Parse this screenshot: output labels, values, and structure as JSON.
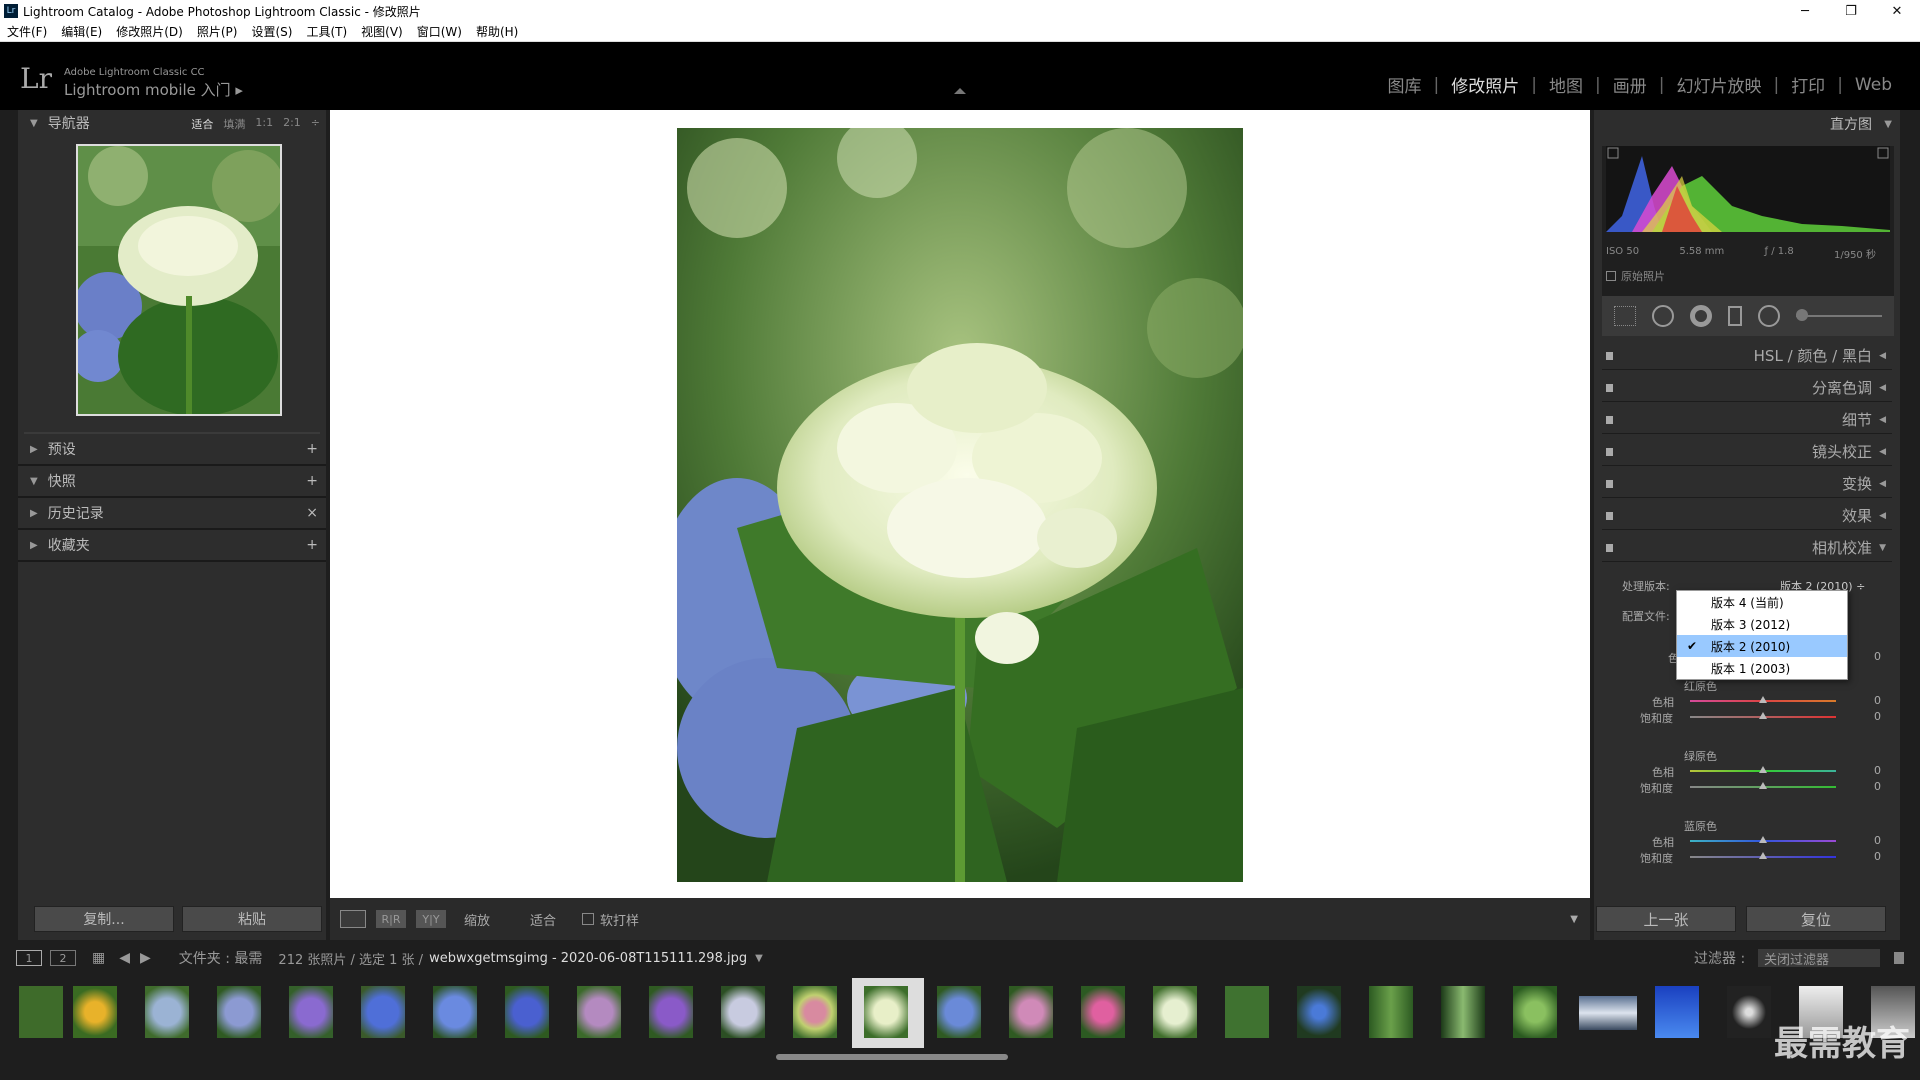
{
  "window": {
    "title": "Lightroom Catalog - Adobe Photoshop Lightroom Classic - 修改照片",
    "app_icon": "Lr"
  },
  "menubar": [
    "文件(F)",
    "编辑(E)",
    "修改照片(D)",
    "照片(P)",
    "设置(S)",
    "工具(T)",
    "视图(V)",
    "窗口(W)",
    "帮助(H)"
  ],
  "identity": {
    "logo": "Lr",
    "line1": "Adobe Lightroom Classic CC",
    "line2": "Lightroom mobile 入门 ▸"
  },
  "modules": {
    "items": [
      "图库",
      "修改照片",
      "地图",
      "画册",
      "幻灯片放映",
      "打印",
      "Web"
    ],
    "active": "修改照片"
  },
  "left_panel": {
    "navigator": {
      "title": "导航器",
      "zoom_options": [
        "适合",
        "填满",
        "1:1",
        "2:1"
      ],
      "selected_zoom": "适合"
    },
    "sections": [
      {
        "label": "预设",
        "action": "+"
      },
      {
        "label": "快照",
        "action": "+"
      },
      {
        "label": "历史记录",
        "action": "×"
      },
      {
        "label": "收藏夹",
        "action": "+"
      }
    ],
    "copy_label": "复制...",
    "paste_label": "粘贴"
  },
  "toolbar": {
    "zoom_label": "缩放",
    "zoom_value": "适合",
    "softproof_label": "软打样"
  },
  "right_panel": {
    "histogram_title": "直方图",
    "exif": [
      "ISO 50",
      "5.58 mm",
      "ƒ / 1.8",
      "1/950 秒"
    ],
    "original_photo_label": "原始照片",
    "sections": [
      {
        "label": "HSL / 颜色 / 黑白"
      },
      {
        "label": "分离色调"
      },
      {
        "label": "细节"
      },
      {
        "label": "镜头校正"
      },
      {
        "label": "变换"
      },
      {
        "label": "效果"
      },
      {
        "label": "相机校准"
      }
    ],
    "calibration": {
      "process_label": "处理版本:",
      "process_value": "版本 2 (2010) ÷",
      "profile_label": "配置文件:",
      "tint_label": "色调",
      "tint_value": "0",
      "red": {
        "title": "红原色",
        "hue_label": "色相",
        "sat_label": "饱和度",
        "hue": "0",
        "sat": "0"
      },
      "green": {
        "title": "绿原色",
        "hue_label": "色相",
        "sat_label": "饱和度",
        "hue": "0",
        "sat": "0"
      },
      "blue": {
        "title": "蓝原色",
        "hue_label": "色相",
        "sat_label": "饱和度",
        "hue": "0",
        "sat": "0"
      }
    },
    "dropdown": {
      "options": [
        "版本 4 (当前)",
        "版本 3 (2012)",
        "版本 2 (2010)",
        "版本 1 (2003)"
      ],
      "selected_index": 2
    },
    "prev_label": "上一张",
    "reset_label": "复位"
  },
  "filmstrip_header": {
    "page1": "1",
    "page2": "2",
    "source": "文件夹 : 最需",
    "count": "212 张照片 / 选定 1 张 /",
    "filename": "webwxgetmsgimg - 2020-06-08T115111.298.jpg",
    "filter_label": "过滤器 :",
    "filter_value": "关闭过滤器"
  },
  "watermark": "最需教育",
  "colors": {
    "panel_bg": "#2d2d2d",
    "selection": "#99c9ff",
    "accent_active_text": "#dddddd"
  }
}
